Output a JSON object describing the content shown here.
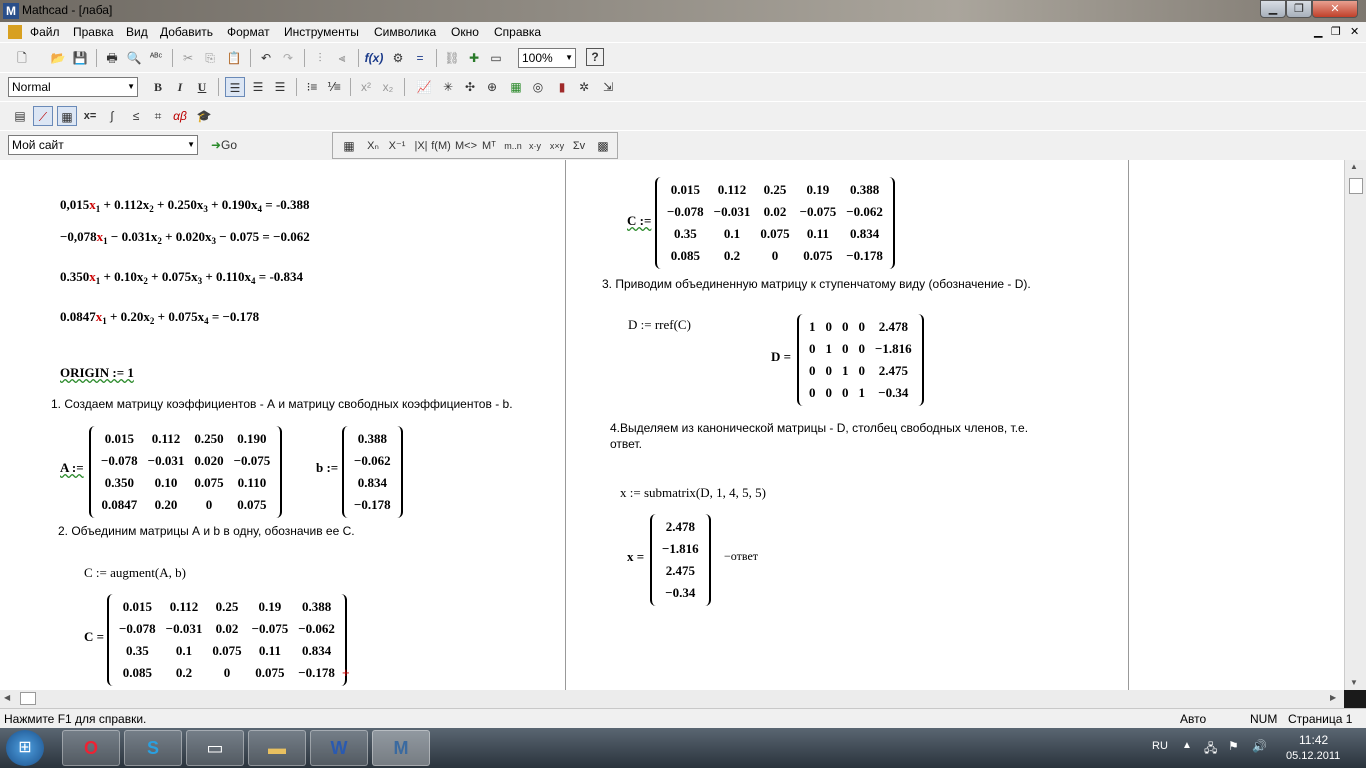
{
  "window": {
    "title": "Mathcad - [лаба]",
    "app_icon": "M"
  },
  "menu": [
    "Файл",
    "Правка",
    "Вид",
    "Добавить",
    "Формат",
    "Инструменты",
    "Символика",
    "Окно",
    "Справка"
  ],
  "toolbar": {
    "zoom": "100%",
    "style": "Normal",
    "font_combo": "Мой сайт",
    "go": "Go",
    "bold": "B",
    "italic": "I",
    "underline": "U"
  },
  "doc": {
    "eq1": "0,015x1 + 0.112x2 + 0.250x3 + 0.190x4 = -0.388",
    "eq2": "−0,078x1 − 0.031x2 + 0.020x3 − 0.075 = −0.062",
    "eq3": "0.350x1 + 0.10x2 + 0.075x3 + 0.110x4 = -0.834",
    "eq4": "0.0847x1 + 0.20x2 + 0.075x4 = −0.178",
    "origin": "ORIGIN := 1",
    "step1": "1. Создаем матрицу коэффициентов - А и матрицу свободных коэффициентов - b.",
    "A_label": "A :=",
    "A": [
      [
        "0.015",
        "0.112",
        "0.250",
        "0.190"
      ],
      [
        "−0.078",
        "−0.031",
        "0.020",
        "−0.075"
      ],
      [
        "0.350",
        "0.10",
        "0.075",
        "0.110"
      ],
      [
        "0.0847",
        "0.20",
        "0",
        "0.075"
      ]
    ],
    "b_label": "b :=",
    "b": [
      [
        "0.388"
      ],
      [
        "−0.062"
      ],
      [
        "0.834"
      ],
      [
        "−0.178"
      ]
    ],
    "step2": "2. Объединим матрицы А и b в одну, обозначив ее С.",
    "C_def": "C := augment(A, b)",
    "C_label": "C =",
    "C": [
      [
        "0.015",
        "0.112",
        "0.25",
        "0.19",
        "0.388"
      ],
      [
        "−0.078",
        "−0.031",
        "0.02",
        "−0.075",
        "−0.062"
      ],
      [
        "0.35",
        "0.1",
        "0.075",
        "0.11",
        "0.834"
      ],
      [
        "0.085",
        "0.2",
        "0",
        "0.075",
        "−0.178"
      ]
    ],
    "C2_label": "C :=",
    "step3": "3. Приводим объединенную матрицу к ступенчатому виду (обозначение - D).",
    "D_def": "D := rref(C)",
    "D_label": "D =",
    "D": [
      [
        "1",
        "0",
        "0",
        "0",
        "2.478"
      ],
      [
        "0",
        "1",
        "0",
        "0",
        "−1.816"
      ],
      [
        "0",
        "0",
        "1",
        "0",
        "2.475"
      ],
      [
        "0",
        "0",
        "0",
        "1",
        "−0.34"
      ]
    ],
    "step4a": "4.Выделяем из канонической матрицы  - D, столбец свободных членов, т.е.",
    "step4b": "ответ.",
    "x_def": "x := submatrix(D, 1, 4, 5, 5)",
    "x_label": "x =",
    "x": [
      [
        "2.478"
      ],
      [
        "−1.816"
      ],
      [
        "2.475"
      ],
      [
        "−0.34"
      ]
    ],
    "answer": "−ответ"
  },
  "status": {
    "help": "Нажмите F1 для справки.",
    "auto": "Авто",
    "num": "NUM",
    "page": "Страница 1"
  },
  "taskbar": {
    "lang": "RU",
    "time": "11:42",
    "date": "05.12.2011"
  }
}
